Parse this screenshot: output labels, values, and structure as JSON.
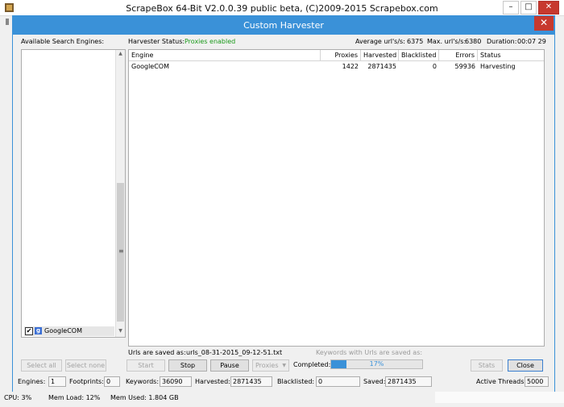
{
  "outer_window": {
    "title": "ScrapeBox 64-Bit V2.0.0.39 public beta, (C)2009-2015 Scrapebox.com",
    "minimize_glyph": "–",
    "maximize_glyph": "□",
    "close_glyph": "✕"
  },
  "dialog": {
    "title": "Custom Harvester",
    "close_glyph": "✕",
    "available_engines_label": "Available Search Engines:",
    "harvester_status_label": "Harvester Status:",
    "harvester_status_value": "Proxies enabled",
    "avg_urls_label": "Average url's/s:",
    "avg_urls_value": "6375",
    "max_urls_label": "Max. url's/s:",
    "max_urls_value": "6380",
    "duration_label": "Duration:",
    "duration_value": "00:07 29"
  },
  "engines": {
    "items": [
      {
        "label": "GoogleCOM",
        "checked": true,
        "icon": "google-icon",
        "check_glyph": "✔",
        "icon_glyph": "g"
      }
    ],
    "scroll_grip": "≡",
    "scroll_up": "▲",
    "scroll_down": "▼"
  },
  "grid": {
    "columns": [
      "Engine",
      "Proxies",
      "Harvested",
      "Blacklisted",
      "Errors",
      "Status"
    ],
    "rows": [
      {
        "engine": "GoogleCOM",
        "proxies": "1422",
        "harvested": "2871435",
        "blacklisted": "0",
        "errors": "59936",
        "status": "Harvesting"
      }
    ]
  },
  "save_info": {
    "urls_label": "Urls are saved as:",
    "urls_file": "urls_08-31-2015_09-12-51.txt",
    "keywords_label": "Keywords with Urls are saved as:"
  },
  "buttons": {
    "select_all": "Select all",
    "select_none": "Select none",
    "start": "Start",
    "stop": "Stop",
    "pause": "Pause",
    "proxies": "Proxies",
    "proxies_arrow": "▼",
    "stats": "Stats",
    "close": "Close"
  },
  "progress": {
    "label": "Completed:",
    "percent": 17,
    "text": "17%"
  },
  "stats_bar": {
    "engines_label": "Engines:",
    "engines_value": "1",
    "footprints_label": "Footprints:",
    "footprints_value": "0",
    "keywords_label": "Keywords:",
    "keywords_value": "36090",
    "harvested_label": "Harvested:",
    "harvested_value": "2871435",
    "blacklisted_label": "Blacklisted:",
    "blacklisted_value": "0",
    "saved_label": "Saved:",
    "saved_value": "2871435",
    "threads_label": "Active Threads:",
    "threads_value": "5000"
  },
  "system_bar": {
    "cpu": "CPU:  3%",
    "mem_load": "Mem Load:  12%",
    "mem_used": "Mem Used:  1.804 GB"
  },
  "colors": {
    "accent": "#3a91d8",
    "status_green": "#1a9a1a",
    "close_red": "#c7392e"
  }
}
